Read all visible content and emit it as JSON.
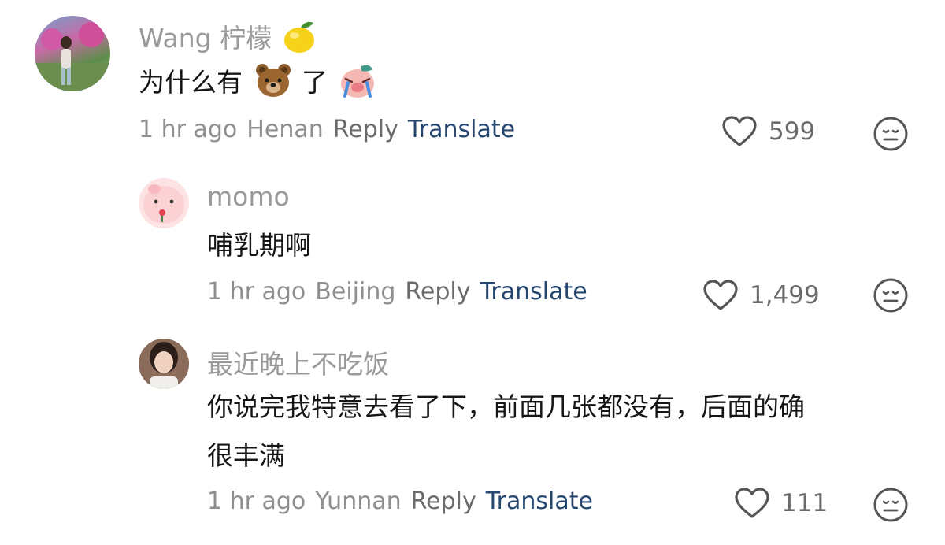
{
  "comments": [
    {
      "username": "Wang 柠檬",
      "username_emoji": "lemon",
      "text_before": "为什么有",
      "text_emoji_1": "bear",
      "text_mid": "了",
      "text_emoji_2": "crying-pig",
      "time": "1 hr ago",
      "location": "Henan",
      "reply_label": "Reply",
      "translate_label": "Translate",
      "likes": "599"
    },
    {
      "username": "momo",
      "text": "哺乳期啊",
      "time": "1 hr ago",
      "location": "Beijing",
      "reply_label": "Reply",
      "translate_label": "Translate",
      "likes": "1,499"
    },
    {
      "username": "最近晚上不吃饭",
      "text_line1": "你说完我特意去看了下，前面几张都没有，后面的确",
      "text_line2": "很丰满",
      "time": "1 hr ago",
      "location": "Yunnan",
      "reply_label": "Reply",
      "translate_label": "Translate",
      "likes": "111"
    }
  ],
  "colors": {
    "username": "#9a9a9a",
    "text": "#161616",
    "meta": "#8f8f8f",
    "reply": "#6b6b6b",
    "translate": "#24466f",
    "icon": "#555555"
  },
  "icons": [
    "heart-outline-icon",
    "dislike-face-icon"
  ]
}
